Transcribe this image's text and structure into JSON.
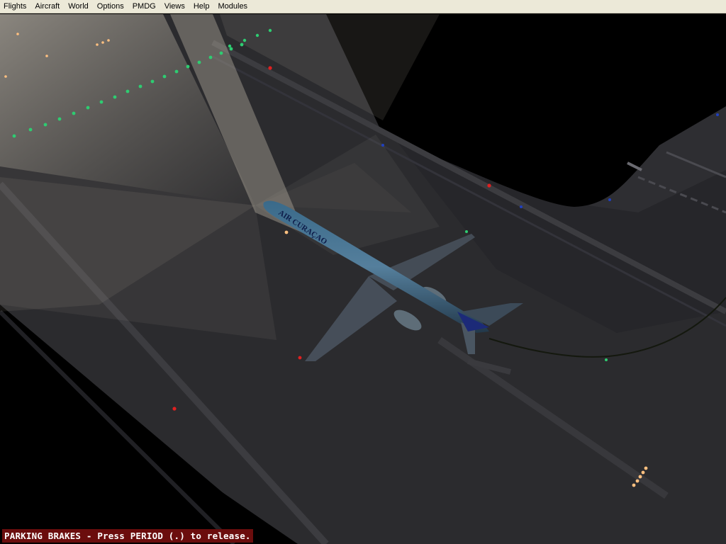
{
  "menu": {
    "items": [
      {
        "id": "flights",
        "label": "Flights"
      },
      {
        "id": "aircraft",
        "label": "Aircraft"
      },
      {
        "id": "world",
        "label": "World"
      },
      {
        "id": "options",
        "label": "Options"
      },
      {
        "id": "pmdg",
        "label": "PMDG"
      },
      {
        "id": "views",
        "label": "Views"
      },
      {
        "id": "help",
        "label": "Help"
      },
      {
        "id": "modules",
        "label": "Modules"
      }
    ]
  },
  "scene": {
    "aircraft_livery_text": "AIR CURAÇAO",
    "colors": {
      "sky": "#000000",
      "tarmac": "#2c2c2f",
      "floodlight": "#c8c0b0",
      "taxi_light": "#2ecc71",
      "edge_light_red": "#e02020",
      "edge_light_blue": "#2040c0",
      "approach_light": "#ffc080"
    }
  },
  "status": {
    "message": "PARKING BRAKES - Press PERIOD (.) to release."
  }
}
